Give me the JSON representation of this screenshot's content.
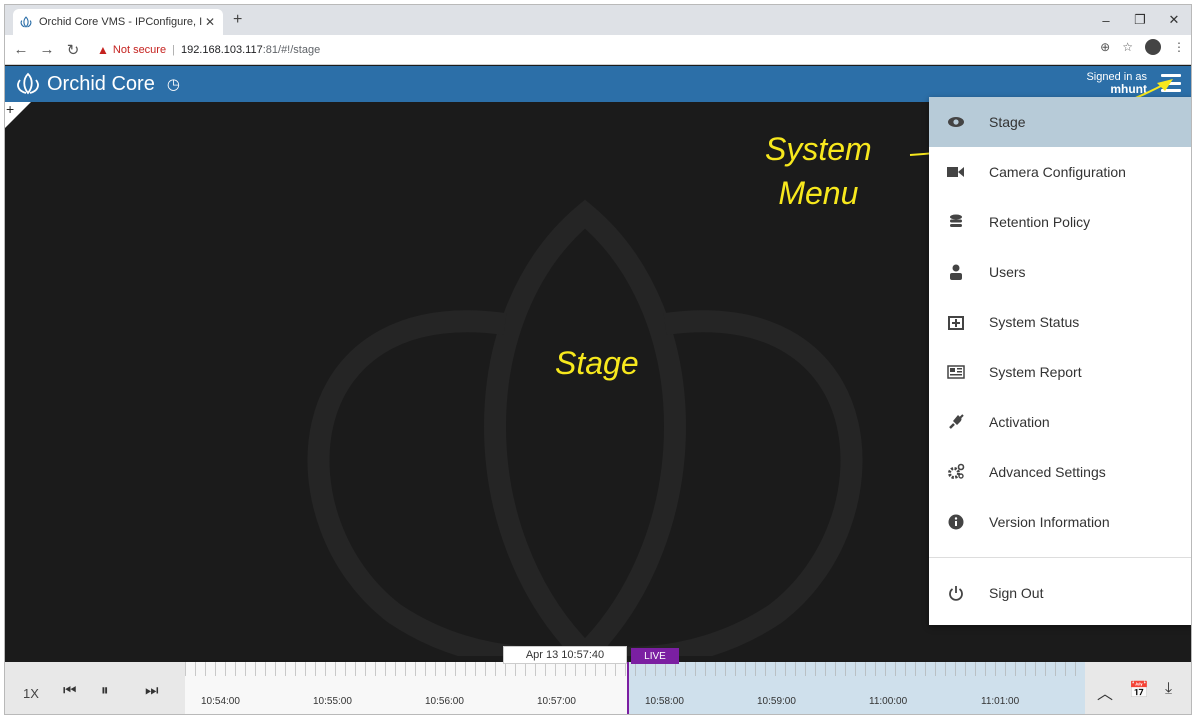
{
  "browser": {
    "tab_title": "Orchid Core VMS - IPConfigure, I",
    "tab_close": "✕",
    "new_tab": "+",
    "window_controls": [
      "–",
      "❐",
      "✕"
    ],
    "not_secure": "Not secure",
    "url_host": "192.168.103.117",
    "url_path": ":81/#!/stage"
  },
  "header": {
    "brand": "Orchid Core",
    "signed_in_as": "Signed in as",
    "username": "mhunt"
  },
  "annotations": {
    "stage": "Stage",
    "system_menu_line1": "System",
    "system_menu_line2": "Menu"
  },
  "menu": {
    "items": [
      {
        "label": "Stage",
        "icon": "eye-icon"
      },
      {
        "label": "Camera Configuration",
        "icon": "video-camera-icon"
      },
      {
        "label": "Retention Policy",
        "icon": "database-icon"
      },
      {
        "label": "Users",
        "icon": "user-icon"
      },
      {
        "label": "System Status",
        "icon": "medkit-icon"
      },
      {
        "label": "System Report",
        "icon": "newspaper-icon"
      },
      {
        "label": "Activation",
        "icon": "plug-icon"
      },
      {
        "label": "Advanced Settings",
        "icon": "gears-icon"
      },
      {
        "label": "Version Information",
        "icon": "info-circle-icon"
      }
    ],
    "sign_out": "Sign Out"
  },
  "timeline": {
    "speed": "1X",
    "current_time": "Apr 13 10:57:40",
    "live": "LIVE",
    "labels": [
      "10:54:00",
      "10:55:00",
      "10:56:00",
      "10:57:00",
      "10:58:00",
      "10:59:00",
      "11:00:00",
      "11:01:00"
    ]
  },
  "colors": {
    "header": "#2c6fa8",
    "active_menu": "#b7cbd8",
    "annotation": "#f7e81d",
    "live": "#7b1fa2"
  }
}
